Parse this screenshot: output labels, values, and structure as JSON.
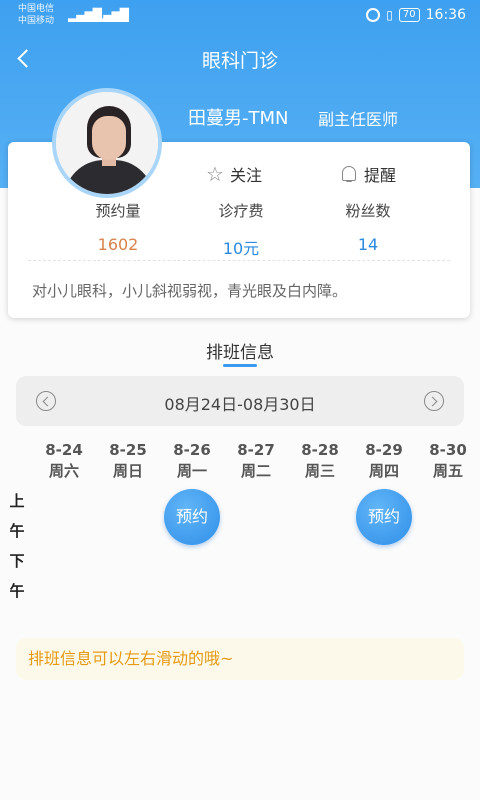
{
  "status_bar": {
    "carrier_1": "中国电信",
    "carrier_2": "中国移动",
    "network_1": "46",
    "network_2": "2G",
    "battery": "70",
    "time": "16:36"
  },
  "header": {
    "title": "眼科门诊",
    "gradient_color": "#3ea0f0"
  },
  "doctor": {
    "name": "田蔓男-TMN",
    "title": "副主任医师",
    "follow_label": "关注",
    "remind_label": "提醒",
    "stats": [
      {
        "label": "预约量",
        "value": "1602",
        "color": "#d8834a"
      },
      {
        "label": "诊疗费",
        "value": "10元",
        "color": "#2a8ae0"
      },
      {
        "label": "粉丝数",
        "value": "14",
        "color": "#2a8ae0"
      }
    ],
    "description": "对小儿眼科，小儿斜视弱视，青光眼及白内障。"
  },
  "schedule": {
    "section_title": "排班信息",
    "week_range": "08月24日-08月30日",
    "days": [
      {
        "date": "8-24",
        "weekday": "周六"
      },
      {
        "date": "8-25",
        "weekday": "周日"
      },
      {
        "date": "8-26",
        "weekday": "周一"
      },
      {
        "date": "8-27",
        "weekday": "周二"
      },
      {
        "date": "8-28",
        "weekday": "周三"
      },
      {
        "date": "8-29",
        "weekday": "周四"
      },
      {
        "date": "8-30",
        "weekday": "周五"
      }
    ],
    "am_label": "上午",
    "pm_label": "下午",
    "book_label": "预约",
    "tip": "排班信息可以左右滑动的哦~"
  }
}
